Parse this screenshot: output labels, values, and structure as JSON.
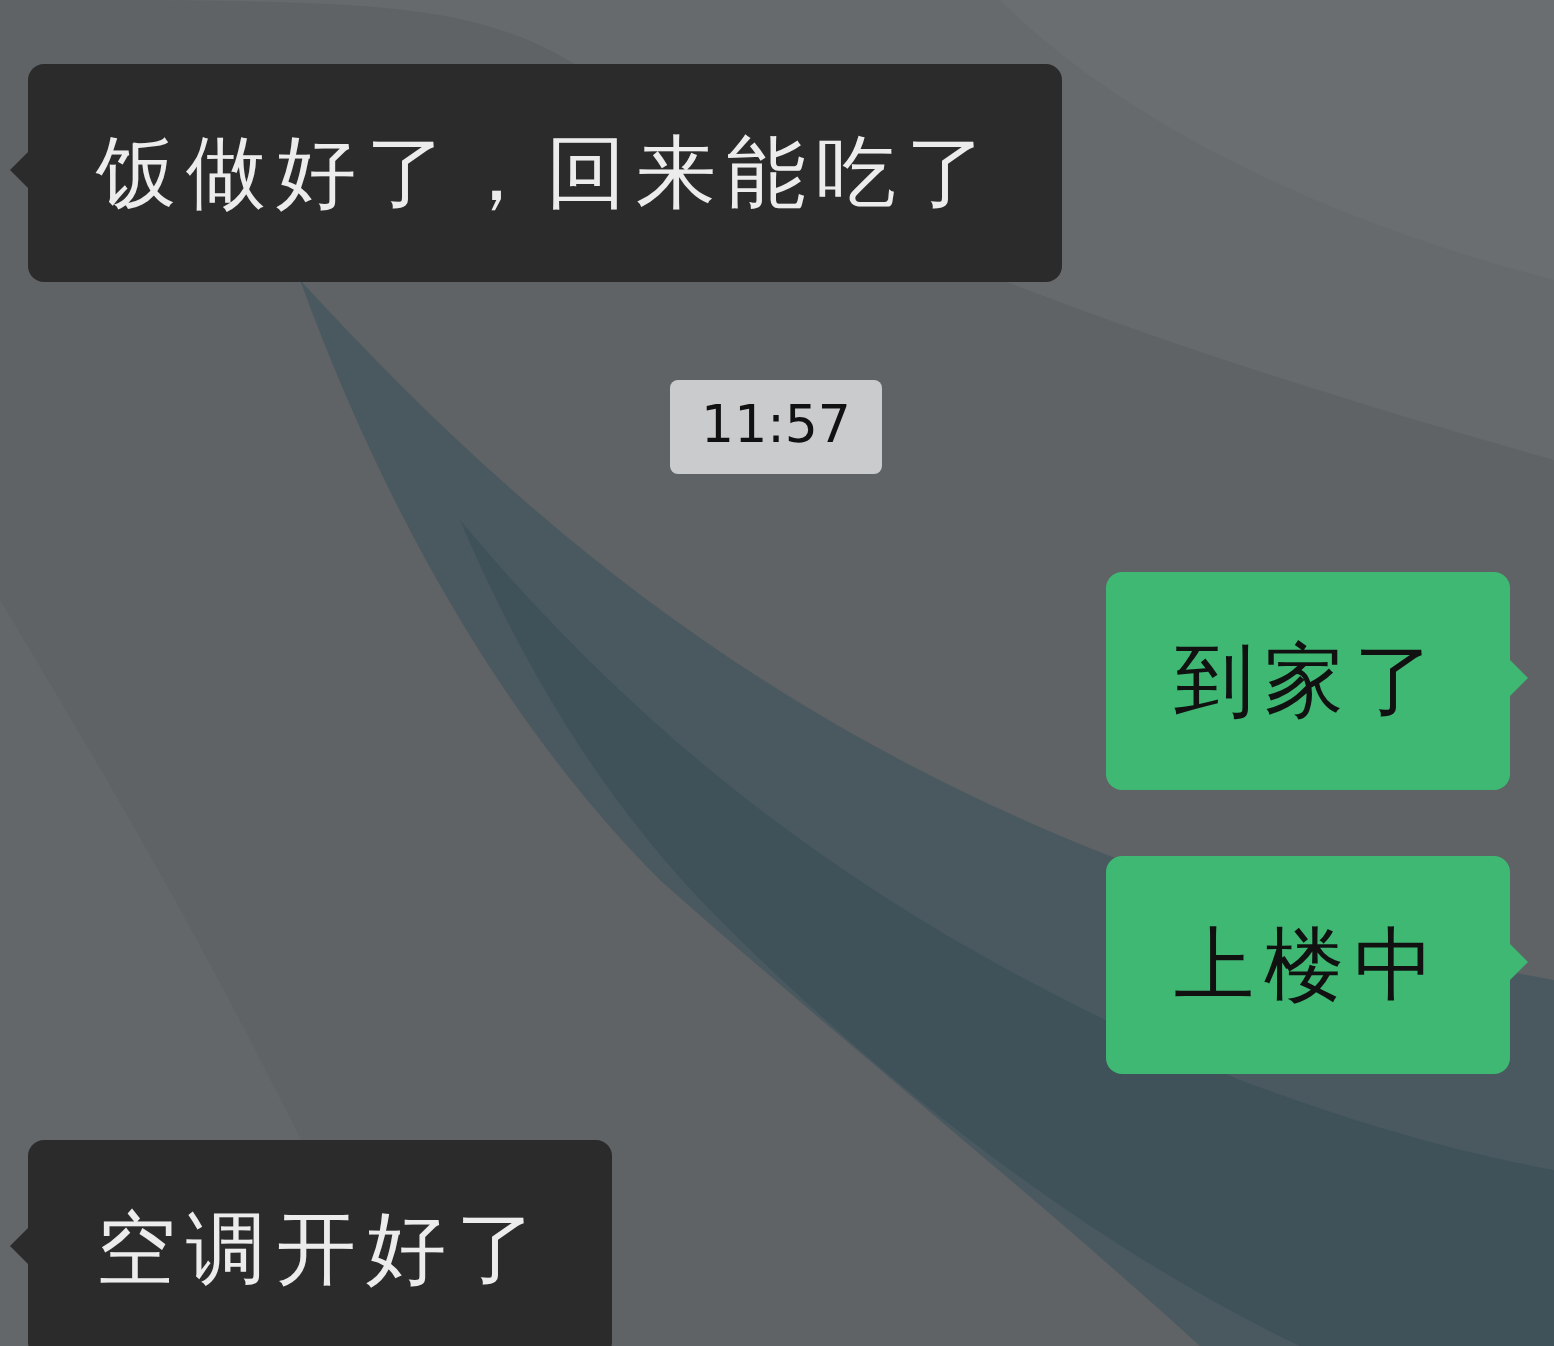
{
  "messages": [
    {
      "kind": "incoming",
      "text": "饭做好了，回来能吃了"
    },
    {
      "kind": "time",
      "text": "11:57"
    },
    {
      "kind": "outgoing",
      "text": "到家了"
    },
    {
      "kind": "outgoing",
      "text": "上楼中"
    },
    {
      "kind": "incoming",
      "text": "空调开好了"
    }
  ]
}
